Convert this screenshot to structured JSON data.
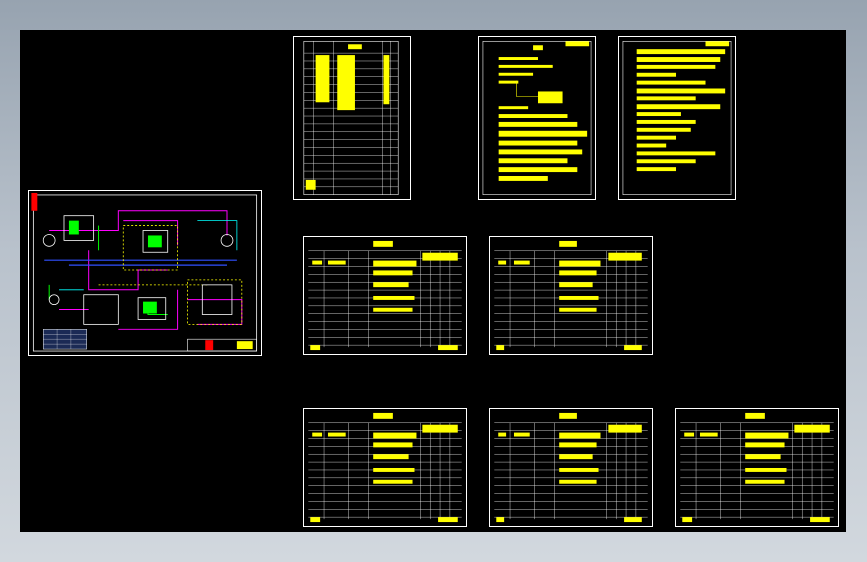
{
  "app": {
    "background_top": "#97a3b0",
    "background_bottom": "#d2d8de",
    "canvas_color": "#000000"
  },
  "colors": {
    "frame": "#ffffff",
    "text": "#ffff00",
    "pipe_magenta": "#ff00ff",
    "pipe_blue": "#3050ff",
    "pipe_green": "#00ff00",
    "pipe_cyan": "#00ffff",
    "accent_red": "#ff0000"
  },
  "sheets": [
    {
      "id": "schematic",
      "kind": "schematic"
    },
    {
      "id": "list-1",
      "kind": "list"
    },
    {
      "id": "notes-1",
      "kind": "notes"
    },
    {
      "id": "notes-2",
      "kind": "notes"
    },
    {
      "id": "table-1",
      "kind": "table"
    },
    {
      "id": "table-2",
      "kind": "table"
    },
    {
      "id": "table-3",
      "kind": "table"
    },
    {
      "id": "table-4",
      "kind": "table"
    },
    {
      "id": "table-5",
      "kind": "table"
    }
  ]
}
